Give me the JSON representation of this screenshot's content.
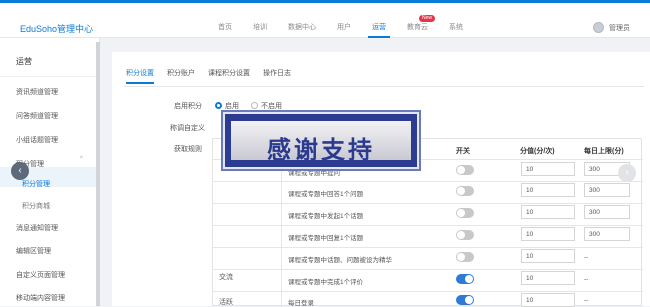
{
  "app": {
    "brand": "EduSoho管理中心"
  },
  "nav": {
    "items": [
      "首页",
      "培训",
      "数据中心",
      "用户",
      "运营",
      "教育云",
      "系统"
    ],
    "active": "运营",
    "badge": "New"
  },
  "user": {
    "name": "管理员"
  },
  "sidebar": {
    "title": "运营",
    "items": [
      "资讯频道管理",
      "问答频道管理",
      "小组话题管理",
      "积分管理",
      "积分管理",
      "积分商城",
      "消息通知管理",
      "编辑区管理",
      "自定义页面管理",
      "移动端内容管理"
    ]
  },
  "tabs": [
    "积分设置",
    "积分账户",
    "课程积分设置",
    "操作日志"
  ],
  "form": {
    "enable_label": "启用积分",
    "enable_on": "启用",
    "enable_off": "不启用",
    "name_label": "积分名称",
    "name_suffix": "称调自定义",
    "rules_label": "获取规则"
  },
  "table": {
    "headers": [
      "开关",
      "分值(分/次)",
      "每日上限(分)"
    ],
    "group_exchange": "交流",
    "group_active": "活跃",
    "rows": [
      {
        "text": "课程或专题中提问",
        "value": "10",
        "limit": "300",
        "on": false
      },
      {
        "text": "课程或专题中回答1个问题",
        "value": "10",
        "limit": "300",
        "on": false
      },
      {
        "text": "课程或专题中发起1个话题",
        "value": "10",
        "limit": "300",
        "on": false
      },
      {
        "text": "课程或专题中回复1个话题",
        "value": "10",
        "limit": "300",
        "on": false
      },
      {
        "text": "课程或专题中话题、问题被设为精华",
        "value": "10",
        "limit": "--",
        "on": false
      },
      {
        "text": "课程或专题中完成1个评价",
        "value": "10",
        "limit": "--",
        "on": true
      },
      {
        "text": "每日登录",
        "value": "10",
        "limit": "--",
        "on": true
      }
    ]
  },
  "overlay": {
    "text": "感谢支持"
  },
  "colors": {
    "accent": "#0b7bd8",
    "toggle_on": "#2f7ad6",
    "overlay_bg": "#2b3c91"
  },
  "icons": {
    "prev": "chevron-left-icon",
    "next": "chevron-right-icon"
  }
}
